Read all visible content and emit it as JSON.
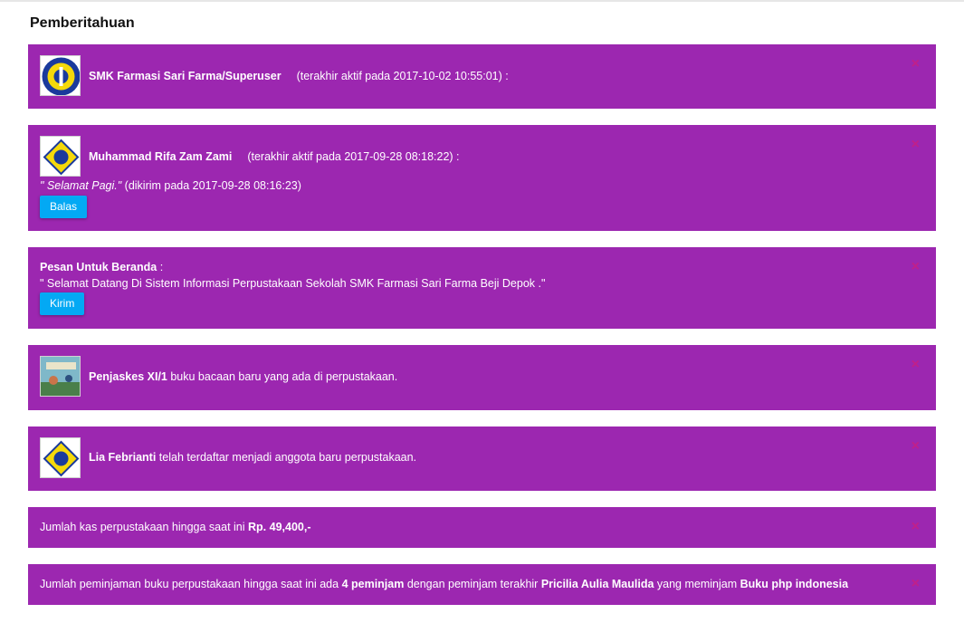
{
  "page": {
    "heading": "Pemberitahuan"
  },
  "notifications": {
    "superuser": {
      "name": "SMK Farmasi Sari Farma/Superuser",
      "meta": "(terakhir aktif pada 2017-10-02 10:55:01) :"
    },
    "message": {
      "name": "Muhammad Rifa Zam Zami",
      "meta": "(terakhir aktif pada 2017-09-28 08:18:22) :",
      "text": "\" Selamat Pagi.\"",
      "sent": "(dikirim pada 2017-09-28 08:16:23)",
      "reply_label": "Balas"
    },
    "home": {
      "title": "Pesan Untuk Beranda",
      "colon": ":",
      "text": "\" Selamat Datang Di Sistem Informasi Perpustakaan Sekolah SMK Farmasi Sari Farma Beji Depok .\"",
      "send_label": "Kirim"
    },
    "book": {
      "title": "Penjaskes XI/1",
      "text": " buku bacaan baru yang ada di perpustakaan."
    },
    "member": {
      "name": "Lia Febrianti",
      "text": " telah terdaftar menjadi anggota baru perpustakaan."
    },
    "cash": {
      "text": "Jumlah kas perpustakaan hingga saat ini ",
      "amount": "Rp. 49,400,-"
    },
    "loan": {
      "prefix": "Jumlah peminjaman buku perpustakaan hingga saat ini ada ",
      "count": "4 peminjam",
      "middle": " dengan peminjam terakhir ",
      "borrower": "Pricilia Aulia Maulida",
      "middle2": " yang meminjam ",
      "book": "Buku php indonesia"
    }
  },
  "close_symbol": "×",
  "colors": {
    "card": "#9c27b0",
    "button": "#03a9f4",
    "close": "#c0208a"
  }
}
